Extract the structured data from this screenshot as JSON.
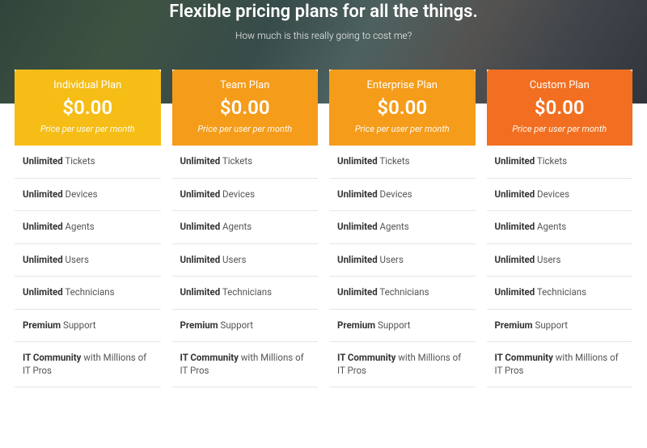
{
  "hero": {
    "title": "Flexible pricing plans for all the things.",
    "subtitle": "How much is this really going to cost me?"
  },
  "note": "Price per user per month",
  "colors": [
    "#f6bd16",
    "#f59c1a",
    "#f59c1a",
    "#f26f21"
  ],
  "plans": [
    {
      "name": "Individual Plan",
      "price": "$0.00"
    },
    {
      "name": "Team Plan",
      "price": "$0.00"
    },
    {
      "name": "Enterprise Plan",
      "price": "$0.00"
    },
    {
      "name": "Custom Plan",
      "price": "$0.00"
    }
  ],
  "features": [
    {
      "bold": "Unlimited",
      "rest": " Tickets"
    },
    {
      "bold": "Unlimited",
      "rest": " Devices"
    },
    {
      "bold": "Unlimited",
      "rest": " Agents"
    },
    {
      "bold": "Unlimited",
      "rest": " Users"
    },
    {
      "bold": "Unlimited",
      "rest": " Technicians"
    },
    {
      "bold": "Premium",
      "rest": " Support"
    },
    {
      "bold": "IT Community",
      "rest": " with Millions of IT Pros"
    }
  ]
}
